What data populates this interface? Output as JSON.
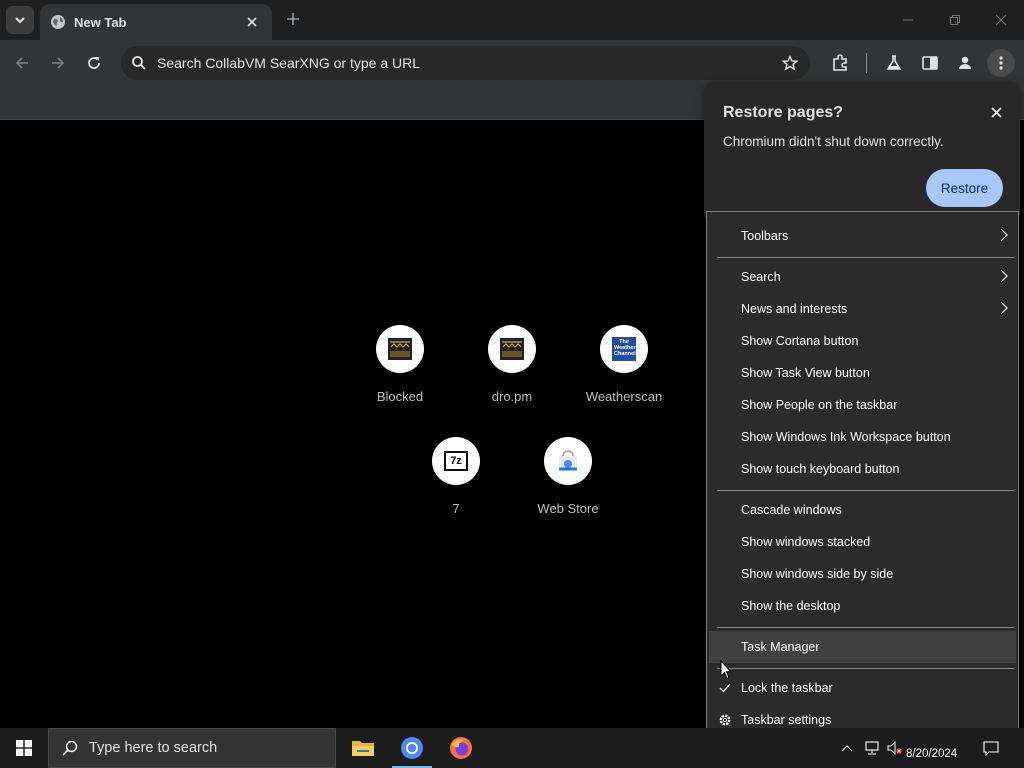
{
  "browser": {
    "tab": {
      "title": "New Tab"
    },
    "omnibox": {
      "placeholder": "Search CollabVM SearXNG or type a URL"
    }
  },
  "shortcuts": [
    {
      "label": "Blocked"
    },
    {
      "label": "dro.pm"
    },
    {
      "label": "Weatherscan",
      "icon_text": "The Weather Channel"
    },
    {
      "label": "7",
      "icon_text": "7z"
    },
    {
      "label": "Web Store"
    }
  ],
  "restore_bubble": {
    "title": "Restore pages?",
    "message": "Chromium didn't shut down correctly.",
    "button": "Restore"
  },
  "context_menu": {
    "items": [
      {
        "label": "Toolbars",
        "submenu": true
      },
      {
        "label": "Search",
        "submenu": true
      },
      {
        "label": "News and interests",
        "submenu": true
      },
      {
        "label": "Show Cortana button"
      },
      {
        "label": "Show Task View button"
      },
      {
        "label": "Show People on the taskbar"
      },
      {
        "label": "Show Windows Ink Workspace button"
      },
      {
        "label": "Show touch keyboard button"
      },
      {
        "label": "Cascade windows"
      },
      {
        "label": "Show windows stacked"
      },
      {
        "label": "Show windows side by side"
      },
      {
        "label": "Show the desktop"
      },
      {
        "label": "Task Manager",
        "highlighted": true
      },
      {
        "label": "Lock the taskbar",
        "checked": true
      },
      {
        "label": "Taskbar settings",
        "icon": "gear-icon"
      }
    ]
  },
  "taskbar": {
    "search_placeholder": "Type here to search",
    "clock_date": "8/20/2024"
  },
  "colors": {
    "accent": "#a8c7fa",
    "accent_text": "#062e6f",
    "taskbar_indicator": "#76b9ed"
  }
}
